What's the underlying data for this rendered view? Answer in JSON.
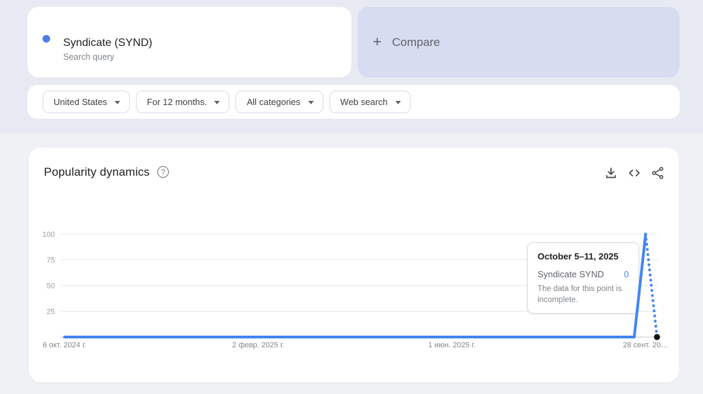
{
  "term_card": {
    "title": "Syndicate (SYND)",
    "subtitle": "Search query",
    "dot_color": "#4d7ce9"
  },
  "compare_card": {
    "plus_glyph": "+",
    "label": "Compare",
    "bg_color": "#d7dcf1"
  },
  "filters": [
    {
      "label": "United States"
    },
    {
      "label": "For 12 months."
    },
    {
      "label": "All categories"
    },
    {
      "label": "Web search"
    }
  ],
  "chart_card": {
    "title": "Popularity dynamics",
    "help_glyph": "?",
    "action_icons": [
      "download-icon",
      "embed-code-icon",
      "share-icon"
    ]
  },
  "tooltip": {
    "date": "October 5–11, 2025",
    "series_label": "Syndicate SYND",
    "value": "0",
    "note": "The data for this point is incomplete."
  },
  "chart_data": {
    "type": "line",
    "title": "Popularity dynamics",
    "series": [
      {
        "name": "Syndicate SYND",
        "color": "#4285f4",
        "values": [
          0,
          0,
          0,
          0,
          0,
          0,
          0,
          0,
          0,
          0,
          0,
          0,
          0,
          0,
          0,
          0,
          0,
          0,
          0,
          0,
          0,
          0,
          0,
          0,
          0,
          0,
          0,
          0,
          0,
          0,
          0,
          0,
          0,
          0,
          0,
          0,
          0,
          0,
          0,
          0,
          0,
          0,
          0,
          0,
          0,
          0,
          0,
          0,
          0,
          0,
          0,
          100,
          0
        ],
        "incomplete_from_index": 51,
        "last_point_incomplete": true
      }
    ],
    "x_unit": "weekly",
    "x_ticks": [
      {
        "label": "6 окт. 2024 г.",
        "index": 0
      },
      {
        "label": "2 февр. 2025 г.",
        "index": 17
      },
      {
        "label": "1 июн. 2025 г.",
        "index": 34
      },
      {
        "label": "28 сент. 20…",
        "index": 51
      }
    ],
    "y_ticks": [
      25,
      50,
      75,
      100
    ],
    "ylim": [
      0,
      100
    ],
    "grid": true,
    "legend_position": "none",
    "hovered_point": {
      "index": 52,
      "value": 0,
      "marker_color": "#141414"
    }
  }
}
